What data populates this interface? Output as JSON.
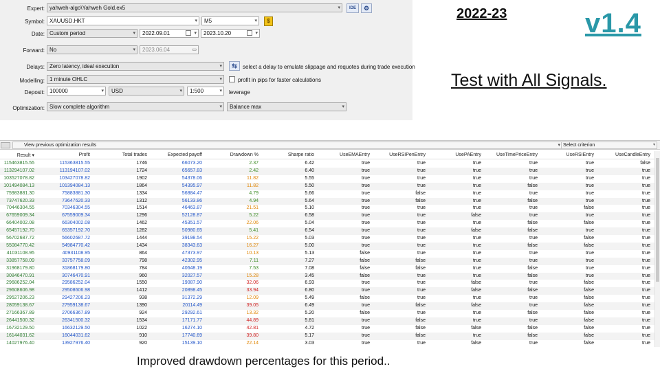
{
  "header": {
    "year": "2022-23",
    "version": "v1.4",
    "subtitle": "Test with All Signals.",
    "caption": "Improved drawdown percentages for this period.."
  },
  "settings": {
    "expert_label": "Expert:",
    "expert_value": "yahweh-algo\\Yahweh Gold.ex5",
    "ide_button": "IDE",
    "symbol_label": "Symbol:",
    "symbol_value": "XAUUSD.HKT",
    "timeframe_value": "M5",
    "date_label": "Date:",
    "date_mode": "Custom period",
    "date_from": "2022.09.01",
    "date_to": "2023.10.20",
    "forward_label": "Forward:",
    "forward_value": "No",
    "forward_date": "2023.06.04",
    "delays_label": "Delays:",
    "delays_value": "Zero latency, ideal execution",
    "delays_hint": "select a delay to emulate slippage and requotes during trade execution",
    "modelling_label": "Modelling:",
    "modelling_value": "1 minute OHLC",
    "profit_pips_label": "profit in pips for faster calculations",
    "deposit_label": "Deposit:",
    "deposit_value": "100000",
    "currency_value": "USD",
    "leverage_value": "1:500",
    "leverage_label": "leverage",
    "optimization_label": "Optimization:",
    "optimization_value": "Slow complete algorithm",
    "criterion_value": "Balance max"
  },
  "results": {
    "toolbar_view": "View previous optimization results",
    "toolbar_criterion": "Select criterion",
    "headers": [
      "Result",
      "Profit",
      "Total trades",
      "Expected payoff",
      "Drawdown %",
      "Sharpe ratio",
      "UseEMAEntry",
      "UseRSIPenEntry",
      "UsePAEntry",
      "UseTimePriceEntry",
      "UseRSIEntry",
      "UseCandleEntry"
    ],
    "rows": [
      [
        "115463815.55",
        "115363815.55",
        "1746",
        "66073.20",
        "2.37",
        "6.42",
        "true",
        "true",
        "true",
        "true",
        "true",
        "false"
      ],
      [
        "113294107.02",
        "113194107.02",
        "1724",
        "65657.83",
        "2.42",
        "6.40",
        "true",
        "true",
        "true",
        "true",
        "true",
        "true"
      ],
      [
        "103527078.82",
        "103427078.82",
        "1902",
        "54378.06",
        "11.82",
        "5.55",
        "true",
        "true",
        "true",
        "true",
        "true",
        "true"
      ],
      [
        "101494084.13",
        "101394084.13",
        "1864",
        "54395.97",
        "11.82",
        "5.50",
        "true",
        "true",
        "true",
        "false",
        "true",
        "true"
      ],
      [
        "75983881.30",
        "75883881.30",
        "1334",
        "56884.47",
        "4.79",
        "5.66",
        "true",
        "false",
        "true",
        "true",
        "true",
        "true"
      ],
      [
        "73747620.33",
        "73647620.33",
        "1312",
        "56133.86",
        "4.94",
        "5.64",
        "true",
        "false",
        "true",
        "false",
        "true",
        "true"
      ],
      [
        "70446304.55",
        "70346304.55",
        "1514",
        "46463.87",
        "21.51",
        "5.10",
        "true",
        "true",
        "true",
        "true",
        "false",
        "true"
      ],
      [
        "67659009.34",
        "67559009.34",
        "1296",
        "52128.87",
        "5.22",
        "6.58",
        "true",
        "true",
        "false",
        "true",
        "true",
        "true"
      ],
      [
        "66404002.08",
        "66304002.08",
        "1462",
        "45351.57",
        "22.06",
        "5.04",
        "true",
        "true",
        "true",
        "false",
        "false",
        "true"
      ],
      [
        "65457192.70",
        "65357192.70",
        "1282",
        "50980.65",
        "5.41",
        "6.54",
        "true",
        "true",
        "false",
        "false",
        "true",
        "true"
      ],
      [
        "56702687.72",
        "56602687.72",
        "1444",
        "39198.54",
        "15.22",
        "5.03",
        "true",
        "true",
        "true",
        "true",
        "false",
        "true"
      ],
      [
        "55084770.42",
        "54984770.42",
        "1434",
        "38343.63",
        "16.27",
        "5.00",
        "true",
        "true",
        "true",
        "false",
        "false",
        "true"
      ],
      [
        "41031108.95",
        "40931108.95",
        "864",
        "47373.97",
        "10.13",
        "5.13",
        "false",
        "true",
        "true",
        "true",
        "true",
        "true"
      ],
      [
        "33857758.09",
        "33757758.09",
        "798",
        "42302.95",
        "7.11",
        "7.27",
        "false",
        "false",
        "true",
        "true",
        "true",
        "true"
      ],
      [
        "31968179.80",
        "31868179.80",
        "784",
        "40648.19",
        "7.53",
        "7.08",
        "false",
        "false",
        "true",
        "false",
        "true",
        "true"
      ],
      [
        "30846470.91",
        "30746470.91",
        "960",
        "32027.57",
        "15.28",
        "3.45",
        "false",
        "true",
        "true",
        "false",
        "true",
        "true"
      ],
      [
        "29686252.04",
        "29586252.04",
        "1550",
        "19087.90",
        "32.06",
        "6.93",
        "true",
        "true",
        "false",
        "true",
        "false",
        "true"
      ],
      [
        "29608606.98",
        "29508606.98",
        "1412",
        "20898.45",
        "33.94",
        "6.80",
        "true",
        "true",
        "false",
        "false",
        "false",
        "true"
      ],
      [
        "29527206.23",
        "29427206.23",
        "938",
        "31372.29",
        "12.09",
        "5.49",
        "false",
        "true",
        "true",
        "true",
        "false",
        "true"
      ],
      [
        "28059138.67",
        "27959138.67",
        "1390",
        "20114.49",
        "39.05",
        "6.49",
        "true",
        "false",
        "false",
        "true",
        "false",
        "true"
      ],
      [
        "27166367.89",
        "27066367.89",
        "924",
        "29292.61",
        "13.32",
        "5.20",
        "false",
        "true",
        "true",
        "false",
        "false",
        "true"
      ],
      [
        "26441500.32",
        "26341500.32",
        "1534",
        "17171.77",
        "44.89",
        "5.81",
        "true",
        "false",
        "true",
        "true",
        "false",
        "true"
      ],
      [
        "16732129.50",
        "16632129.50",
        "1022",
        "16274.10",
        "42.81",
        "4.72",
        "true",
        "false",
        "false",
        "false",
        "false",
        "true"
      ],
      [
        "16144031.62",
        "16044031.62",
        "910",
        "17740.69",
        "39.80",
        "5.17",
        "true",
        "false",
        "true",
        "false",
        "false",
        "true"
      ],
      [
        "14027976.40",
        "13927976.40",
        "920",
        "15139.10",
        "22.14",
        "3.03",
        "true",
        "true",
        "false",
        "true",
        "false",
        "true"
      ]
    ]
  }
}
